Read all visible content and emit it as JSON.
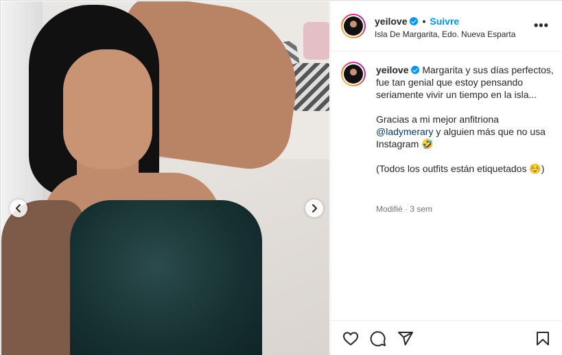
{
  "post": {
    "username": "yeilove",
    "follow_label": "Suivre",
    "location": "Isla De Margarita, Edo. Nueva Esparta",
    "more_label": "•••"
  },
  "caption": {
    "username": "yeilove",
    "text_part1": "Margarita y sus días perfectos, fue tan genial que estoy pensando seriamente vivir un tiempo en la isla...\n\nGracias a mi mejor anfitriona ",
    "mention": "@ladymerary",
    "text_part2": " y alguien más que no usa Instagram 🤣\n\n(Todos los outfits están etiquetados ☺️)",
    "meta": "Modifié · 3 sem"
  },
  "icons": {
    "verified": "verified-badge-icon",
    "prev": "chevron-left-icon",
    "next": "chevron-right-icon",
    "like": "heart-icon",
    "comment": "comment-icon",
    "share": "share-icon",
    "save": "bookmark-icon"
  },
  "colors": {
    "accent": "#0095f6",
    "mention": "#00376b",
    "meta": "#737373",
    "text": "#262626"
  }
}
